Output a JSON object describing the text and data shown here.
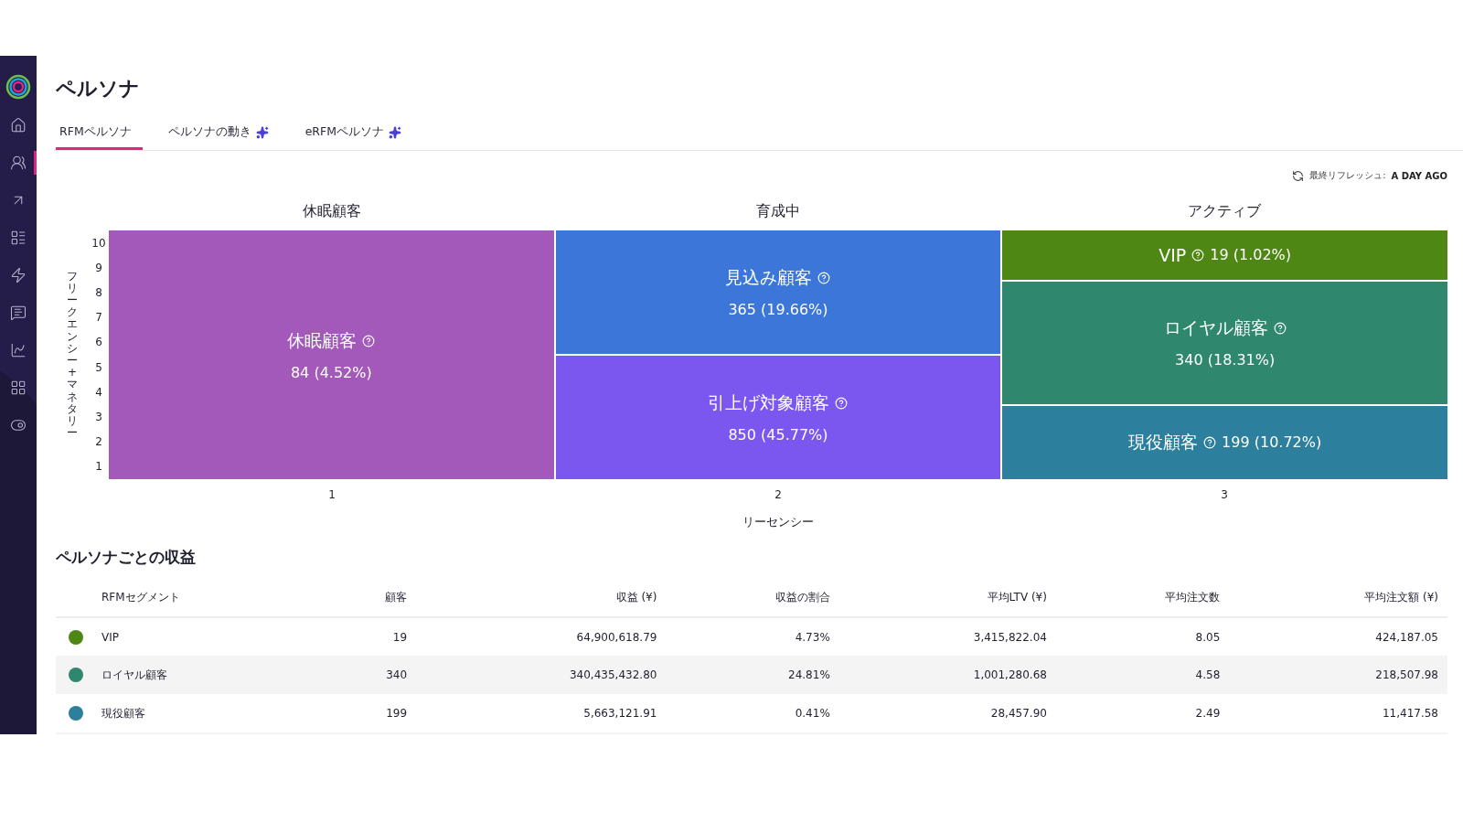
{
  "page": {
    "title": "ペルソナ"
  },
  "sidebar": {
    "items": [
      {
        "selected": false
      },
      {
        "selected": true
      },
      {
        "selected": false
      },
      {
        "selected": false
      },
      {
        "selected": false
      },
      {
        "selected": false
      },
      {
        "selected": false
      },
      {
        "selected": false
      },
      {
        "selected": false
      }
    ]
  },
  "tabs": [
    {
      "label": "RFMペルソナ",
      "selected": true,
      "sparkle": false
    },
    {
      "label": "ペルソナの動き",
      "selected": false,
      "sparkle": true
    },
    {
      "label": "eRFMペルソナ",
      "selected": false,
      "sparkle": true
    }
  ],
  "refresh": {
    "label": "最終リフレッシュ:",
    "value": "A DAY AGO"
  },
  "matrix": {
    "columns": [
      {
        "heading": "休眠顧客",
        "x_label": "1",
        "cells": [
          {
            "name": "休眠顧客",
            "count": "84 (4.52%)",
            "kind": "stacked",
            "color": "#a259b9"
          }
        ]
      },
      {
        "heading": "育成中",
        "x_label": "2",
        "cells": [
          {
            "name": "見込み顧客",
            "count": "365 (19.66%)",
            "kind": "stacked",
            "color": "#3d76d9"
          },
          {
            "name": "引上げ対象顧客",
            "count": "850 (45.77%)",
            "kind": "stacked",
            "color": "#7b57f0"
          }
        ]
      },
      {
        "heading": "アクティブ",
        "x_label": "3",
        "cells": [
          {
            "name": "VIP",
            "count": "19 (1.02%)",
            "kind": "inline",
            "color": "#4e8713"
          },
          {
            "name": "ロイヤル顧客",
            "count": "340 (18.31%)",
            "kind": "stacked",
            "color": "#2f886d"
          },
          {
            "name": "現役顧客",
            "count": "199 (10.72%)",
            "kind": "inline",
            "color": "#2c7f9d"
          }
        ]
      }
    ],
    "y_ticks": [
      "10",
      "9",
      "8",
      "7",
      "6",
      "5",
      "4",
      "3",
      "2",
      "1"
    ],
    "y_title": "フリークエンシー+マネタリー",
    "x_title": "リーセンシー"
  },
  "revenue": {
    "title": "ペルソナごとの収益",
    "columns": [
      "RFMセグメント",
      "顧客",
      "収益 (¥)",
      "収益の割合",
      "平均LTV (¥)",
      "平均注文数",
      "平均注文額 (¥)"
    ],
    "rows": [
      {
        "color": "#4e8713",
        "cells": [
          "VIP",
          "19",
          "64,900,618.79",
          "4.73%",
          "3,415,822.04",
          "8.05",
          "424,187.05"
        ]
      },
      {
        "color": "#2f886d",
        "cells": [
          "ロイヤル顧客",
          "340",
          "340,435,432.80",
          "24.81%",
          "1,001,280.68",
          "4.58",
          "218,507.98"
        ]
      },
      {
        "color": "#2c7f9d",
        "cells": [
          "現役顧客",
          "199",
          "5,663,121.91",
          "0.41%",
          "28,457.90",
          "2.49",
          "11,417.58"
        ]
      }
    ]
  }
}
